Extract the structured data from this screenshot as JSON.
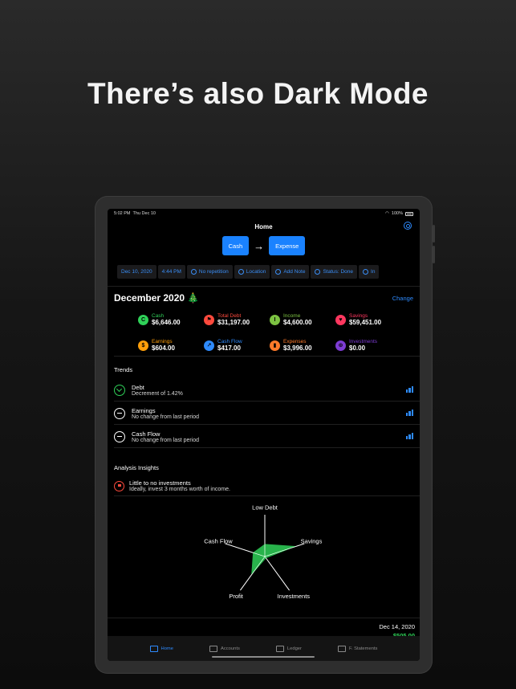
{
  "headline": "There’s also Dark Mode",
  "status_bar": {
    "time": "5:02 PM",
    "date": "Thu Dec 10",
    "battery": "100%"
  },
  "nav": {
    "title": "Home"
  },
  "toggle": {
    "from": "Cash",
    "to": "Expense"
  },
  "chips": [
    {
      "label": "Dec 10, 2020",
      "icon": ""
    },
    {
      "label": "4:44 PM",
      "icon": ""
    },
    {
      "label": "No repetition",
      "icon": "repeat-icon"
    },
    {
      "label": "Location",
      "icon": "location-arrow-icon"
    },
    {
      "label": "Add Note",
      "icon": "note-icon"
    },
    {
      "label": "Status: Done",
      "icon": "check-icon"
    },
    {
      "label": "In",
      "icon": "minus-circle-icon"
    }
  ],
  "month": {
    "title": "December 2020 🎄",
    "change_label": "Change"
  },
  "stats": [
    {
      "label": "Cash",
      "value": "$6,646.00",
      "color": "#2fd158",
      "icon": "C"
    },
    {
      "label": "Total Debt",
      "value": "$31,197.00",
      "color": "#ff4a3d",
      "icon": "⚑"
    },
    {
      "label": "Income",
      "value": "$4,600.00",
      "color": "#7cc242",
      "icon": "I"
    },
    {
      "label": "Savings",
      "value": "$59,451.00",
      "color": "#ff375f",
      "icon": "♥"
    },
    {
      "label": "Earnings",
      "value": "$604.00",
      "color": "#ff9f0a",
      "icon": "$"
    },
    {
      "label": "Cash Flow",
      "value": "$417.00",
      "color": "#2e8bff",
      "icon": "↗"
    },
    {
      "label": "Expenses",
      "value": "$3,996.00",
      "color": "#ff7a2a",
      "icon": "▮"
    },
    {
      "label": "Investments",
      "value": "$0.00",
      "color": "#7d3cd3",
      "icon": "⊛"
    }
  ],
  "trends": {
    "title": "Trends",
    "items": [
      {
        "name": "Debt",
        "detail": "Decrement of 1.42%",
        "icon": "down"
      },
      {
        "name": "Earnings",
        "detail": "No change from last period",
        "icon": "dash"
      },
      {
        "name": "Cash Flow",
        "detail": "No change from last period",
        "icon": "dash"
      }
    ]
  },
  "insights": {
    "title": "Analysis Insights",
    "items": [
      {
        "name": "Little to no investments",
        "detail": "Ideally, invest 3 months worth of income."
      }
    ]
  },
  "radar": {
    "axes": [
      "Low Debt",
      "Savings",
      "Investments",
      "Profit",
      "Cash Flow"
    ],
    "values": [
      0.3,
      0.8,
      0.05,
      0.55,
      0.3
    ],
    "color": "#2fd158"
  },
  "footer": {
    "date": "Dec 14, 2020",
    "amount": "$505.00"
  },
  "tabs": [
    {
      "label": "Home",
      "icon": "house-icon",
      "active": true
    },
    {
      "label": "Accounts",
      "icon": "card-icon",
      "active": false
    },
    {
      "label": "Ledger",
      "icon": "book-icon",
      "active": false
    },
    {
      "label": "F. Statements",
      "icon": "chart-stack-icon",
      "active": false
    }
  ]
}
